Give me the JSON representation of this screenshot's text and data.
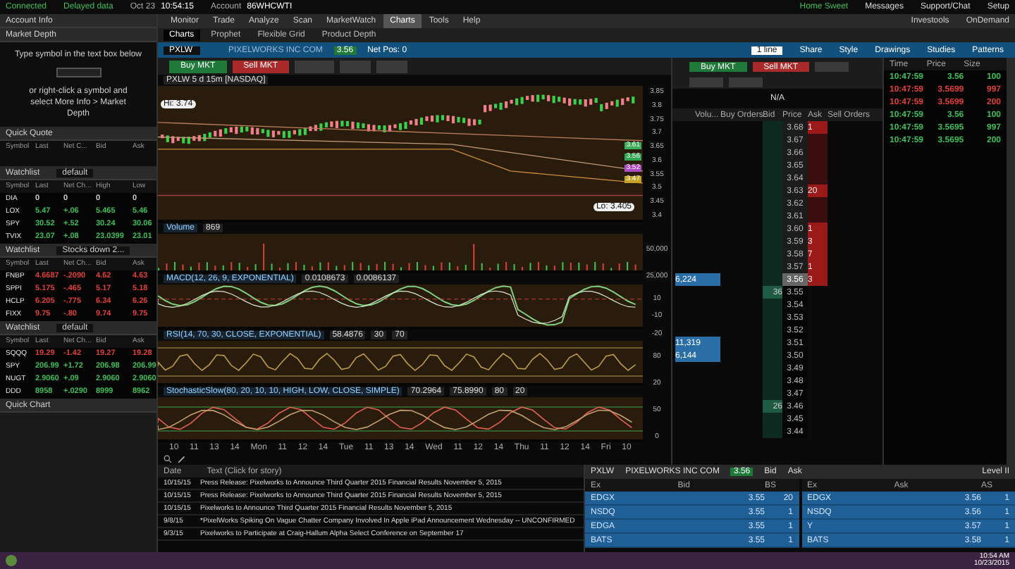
{
  "status_bar": {
    "connection": "Connected",
    "data": "Delayed data",
    "date": "Oct 23",
    "time": "10:54:15",
    "account_label": "Account",
    "account": "86WHCWTI",
    "links": [
      "Home Sweet",
      "Messages",
      "Support/Chat",
      "Setup"
    ]
  },
  "menu": {
    "tabs": [
      {
        "label": "Monitor",
        "selected": false
      },
      {
        "label": "Trade",
        "selected": false
      },
      {
        "label": "Analyze",
        "selected": false
      },
      {
        "label": "Scan",
        "selected": false
      },
      {
        "label": "MarketWatch",
        "selected": false
      },
      {
        "label": "Charts",
        "selected": true
      },
      {
        "label": "Tools",
        "selected": false
      },
      {
        "label": "Help",
        "selected": false
      }
    ],
    "links": [
      "Investools",
      "OnDemand"
    ]
  },
  "subtabs": [
    {
      "label": "Charts",
      "selected": true
    },
    {
      "label": "Prophet",
      "selected": false
    },
    {
      "label": "Flexible Grid",
      "selected": false
    },
    {
      "label": "Product Depth",
      "selected": false
    }
  ],
  "symbol_bar": {
    "symbol": "PXLW",
    "name": "PIXELWORKS INC COM",
    "last": "3.56",
    "net_pos": "Net Pos: 0",
    "tools": [
      "Share",
      "Style",
      "Drawings",
      "Studies",
      "Patterns"
    ],
    "zoom": "1 line"
  },
  "sidebar": {
    "account_info": "Account Info",
    "market_depth": {
      "title": "Market Depth",
      "hint": "Type symbol in the text box below",
      "help": "or right-click a symbol and select More Info > Market Depth"
    },
    "quick_quote": {
      "title": "Quick Quote",
      "columns": [
        "Symbol",
        "Last",
        "Net C...",
        "Bid",
        "Ask"
      ]
    },
    "watchlists": [
      {
        "title": "Watchlist",
        "name": "default",
        "columns": [
          "Symbol",
          "Last",
          "Net Ch...",
          "High",
          "Low"
        ],
        "rows": [
          {
            "cells": [
              "DIA",
              "0",
              "0",
              "0",
              "0"
            ],
            "color": "#d0d0d0"
          },
          {
            "cells": [
              "LOX",
              "5.47",
              "+.06",
              "5.465",
              "5.46"
            ],
            "color": "#3fbf5a"
          },
          {
            "cells": [
              "SPY",
              "30.52",
              "+.52",
              "30.24",
              "30.06"
            ],
            "color": "#3fbf5a"
          },
          {
            "cells": [
              "TVIX",
              "23.07",
              "+.08",
              "23.0399",
              "23.01"
            ],
            "color": "#3fbf5a"
          }
        ]
      },
      {
        "title": "Watchlist",
        "name": "Stocks down 2...",
        "columns": [
          "Symbol",
          "Last",
          "Net Ch...",
          "Bid",
          "Ask"
        ],
        "rows": [
          {
            "cells": [
              "FNBP",
              "4.6687",
              "-.2090",
              "4.62",
              "4.63"
            ],
            "color": "#e0403a"
          },
          {
            "cells": [
              "SPPI",
              "5.175",
              "-.465",
              "5.17",
              "5.18"
            ],
            "color": "#e0403a"
          },
          {
            "cells": [
              "HCLP",
              "6.205",
              "-.775",
              "6.34",
              "6.26"
            ],
            "color": "#e0403a"
          },
          {
            "cells": [
              "FIXX",
              "9.75",
              "-.80",
              "9.74",
              "9.75"
            ],
            "color": "#e0403a"
          }
        ]
      },
      {
        "title": "Watchlist",
        "name": "default",
        "columns": [
          "Symbol",
          "Last",
          "Net Ch...",
          "Bid",
          "Ask"
        ],
        "rows": [
          {
            "cells": [
              "SQQQ",
              "19.29",
              "-1.42",
              "19.27",
              "19.28"
            ],
            "color": "#e0403a"
          },
          {
            "cells": [
              "SPY",
              "206.99",
              "+1.72",
              "206.98",
              "206.99"
            ],
            "color": "#3fbf5a"
          },
          {
            "cells": [
              "NUGT",
              "2.9060",
              "+.09",
              "2.9060",
              "2.9060"
            ],
            "color": "#3fbf5a"
          },
          {
            "cells": [
              "DDD",
              "8958",
              "+.0290",
              "8999",
              "8962"
            ],
            "color": "#3fbf5a"
          }
        ]
      }
    ],
    "quick_chart": "Quick Chart"
  },
  "chart": {
    "buy": "Buy MKT",
    "sell": "Sell MKT",
    "title": "PXLW 5 d 15m [NASDAQ]",
    "price_badge": "Hi: 3.74",
    "low_badge": "Lo: 3.405",
    "price_ticks": [
      "3.85",
      "3.8",
      "3.75",
      "3.7",
      "3.65",
      "3.6",
      "3.55",
      "3.5",
      "3.45",
      "3.4"
    ],
    "price_markers": [
      {
        "label": "3.61",
        "color": "#3fae5a"
      },
      {
        "label": "3.56",
        "color": "#2fa84f"
      },
      {
        "label": "3.52",
        "color": "#b04cc2"
      },
      {
        "label": "3.47",
        "color": "#c7a325"
      }
    ],
    "panes": [
      {
        "kind": "volume",
        "label": "Volume",
        "value": "869",
        "ticks": [
          "50,000",
          "25,000"
        ]
      },
      {
        "kind": "macd",
        "label": "MACD(12, 26, 9, EXPONENTIAL)",
        "value": "0.0108673",
        "extra": "0.0086137",
        "ticks": [
          "10",
          "-10",
          "-20"
        ]
      },
      {
        "kind": "rsi",
        "label": "RSI(14, 70, 30, CLOSE, EXPONENTIAL)",
        "value": "58.4876",
        "extra": "30",
        "extra2": "70",
        "ticks": [
          "80",
          "20"
        ]
      },
      {
        "kind": "stoch",
        "label": "StochasticSlow(80, 20, 10, 10, HIGH, LOW, CLOSE, SIMPLE)",
        "value": "70.2964",
        "extra": "75.8990",
        "extra2": "80",
        "extra3": "20",
        "ticks": [
          "50",
          "0"
        ]
      }
    ],
    "x_labels": [
      "10",
      "11",
      "13",
      "14",
      "Mon",
      "11",
      "12",
      "14",
      "Tue",
      "11",
      "13",
      "14",
      "Wed",
      "11",
      "12",
      "14",
      "Thu",
      "11",
      "12",
      "14",
      "Fri",
      "10"
    ]
  },
  "depth": {
    "buy": "Buy MKT",
    "sell": "Sell MKT",
    "last": "N/A",
    "columns": [
      "Volu...",
      "Buy Orders",
      "Bid",
      "Price",
      "Ask",
      "Sell Orders"
    ],
    "rows": [
      {
        "price": "3.68",
        "ask": "1",
        "selected": false
      },
      {
        "price": "3.67",
        "selected": false
      },
      {
        "price": "3.66",
        "selected": false
      },
      {
        "price": "3.65",
        "selected": false
      },
      {
        "price": "3.64",
        "selected": false
      },
      {
        "price": "3.63",
        "ask": "20",
        "selected": false
      },
      {
        "price": "3.62",
        "selected": false
      },
      {
        "price": "3.61",
        "selected": false
      },
      {
        "price": "3.60",
        "ask": "1",
        "selected": false
      },
      {
        "price": "3.59",
        "ask": "3",
        "selected": false
      },
      {
        "price": "3.58",
        "ask": "7",
        "selected": false
      },
      {
        "price": "3.57",
        "ask": "1",
        "selected": false
      },
      {
        "price": "3.56",
        "ask": "3",
        "volume": "6,224",
        "selected": true
      },
      {
        "price": "3.55",
        "bid": "36",
        "selected": false
      },
      {
        "price": "3.54",
        "selected": false
      },
      {
        "price": "3.53",
        "selected": false
      },
      {
        "price": "3.52",
        "selected": false
      },
      {
        "price": "3.51",
        "volume": "11,319",
        "selected": false
      },
      {
        "price": "3.50",
        "volume": "6,144",
        "selected": false
      },
      {
        "price": "3.49",
        "selected": false
      },
      {
        "price": "3.48",
        "selected": false
      },
      {
        "price": "3.47",
        "selected": false
      },
      {
        "price": "3.46",
        "bid": "26",
        "selected": false
      },
      {
        "price": "3.45",
        "selected": false
      },
      {
        "price": "3.44",
        "selected": false
      }
    ]
  },
  "time_sales": {
    "columns": [
      "Time",
      "Price",
      "Size"
    ],
    "rows": [
      {
        "time": "10:47:59",
        "price": "3.56",
        "size": "100",
        "color": "#3fbf5a"
      },
      {
        "time": "10:47:59",
        "price": "3.5699",
        "size": "997",
        "color": "#e0403a"
      },
      {
        "time": "10:47:59",
        "price": "3.5699",
        "size": "200",
        "color": "#e0403a"
      },
      {
        "time": "10:47:59",
        "price": "3.56",
        "size": "100",
        "color": "#3fbf5a"
      },
      {
        "time": "10:47:59",
        "price": "3.5695",
        "size": "997",
        "color": "#3fbf5a"
      },
      {
        "time": "10:47:59",
        "price": "3.5695",
        "size": "200",
        "color": "#3fbf5a"
      }
    ]
  },
  "news": {
    "columns": [
      "Date",
      "Text (Click for story)"
    ],
    "rows": [
      [
        "10/15/15",
        "Press Release: Pixelworks to Announce Third Quarter 2015 Financial Results November 5, 2015"
      ],
      [
        "10/15/15",
        "Press Release: Pixelworks to Announce Third Quarter 2015 Financial Results November 5, 2015"
      ],
      [
        "10/15/15",
        "Pixelworks to Announce Third Quarter 2015 Financial Results November 5, 2015"
      ],
      [
        "9/8/15",
        "*PixelWorks Spiking On Vague Chatter Company Involved In Apple iPad Announcement Wednesday -- UNCONFIRMED"
      ],
      [
        "9/3/15",
        "Pixelworks to Participate at Craig-Hallum Alpha Select Conference on September 17"
      ]
    ]
  },
  "level2": {
    "symbol": "PXLW",
    "name": "PIXELWORKS INC COM",
    "last": "3.56",
    "bid_label": "Bid",
    "ask_label": "Ask",
    "title": "Level II",
    "bid_columns": [
      "Ex",
      "Bid",
      "BS"
    ],
    "ask_columns": [
      "Ex",
      "Ask",
      "AS"
    ],
    "bids": [
      [
        "EDGX",
        "3.55",
        "20"
      ],
      [
        "NSDQ",
        "3.55",
        "1"
      ],
      [
        "EDGA",
        "3.55",
        "1"
      ],
      [
        "BATS",
        "3.55",
        "1"
      ]
    ],
    "asks": [
      [
        "EDGX",
        "3.56",
        "1"
      ],
      [
        "NSDQ",
        "3.56",
        "1"
      ],
      [
        "Y",
        "3.57",
        "1"
      ],
      [
        "BATS",
        "3.58",
        "1"
      ]
    ]
  },
  "taskbar": {
    "time": "10:54 AM",
    "date": "10/23/2015"
  }
}
